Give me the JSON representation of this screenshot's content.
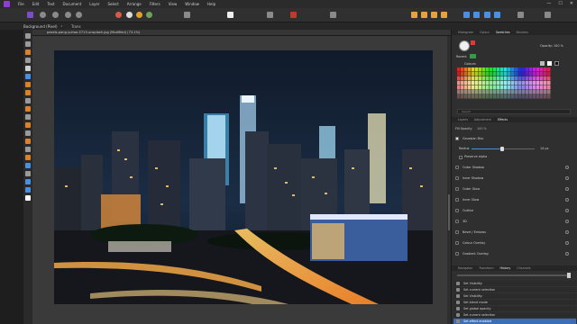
{
  "menu": [
    "File",
    "Edit",
    "Text",
    "Document",
    "Layer",
    "Select",
    "Arrange",
    "Filters",
    "View",
    "Window",
    "Help"
  ],
  "window_controls": [
    "—",
    "☐",
    "✕"
  ],
  "context": {
    "layer": "Background (Pixel)",
    "transparency_label": "Trans"
  },
  "document_tab": "pexels-pang-yuhao-5713-unsplash.jpg (Modified) (73.1%)",
  "colour_panel": {
    "tabs": [
      "Histogram",
      "Colour",
      "Swatches",
      "Brushes"
    ],
    "active_tab": "Swatches",
    "opacity_label": "Opacity:",
    "opacity_value": "100 %",
    "recent_label": "Recent",
    "palette_name": "Colours",
    "fill_color": "#e53935",
    "recent_color": "#2f9e45",
    "search_placeholder": "Search"
  },
  "fx_panel": {
    "tabs": [
      "Layers",
      "Adjustment",
      "Effects"
    ],
    "active_tab": "Effects",
    "opacity_label": "Fill Opacity",
    "opacity_value": "100 %",
    "gaussian_blur_label": "Gaussian Blur",
    "radius_label": "Radius",
    "radius_value": "14 px",
    "radius_fraction": 0.49,
    "preserve_alpha_label": "Preserve alpha",
    "effects": [
      "Outer Shadow",
      "Inner Shadow",
      "Outer Glow",
      "Inner Glow",
      "Outline",
      "3D",
      "Bevel / Emboss",
      "Colour Overlay",
      "Gradient Overlay"
    ]
  },
  "history_panel": {
    "tabs": [
      "Navigator",
      "Transform",
      "History",
      "Channels"
    ],
    "active_tab": "History",
    "items": [
      "Set Visibility",
      "Set current selection",
      "Set Visibility",
      "Set blend mode",
      "Set global opacity",
      "Set current selection",
      "Set effect enabled"
    ],
    "active_index": 6
  }
}
